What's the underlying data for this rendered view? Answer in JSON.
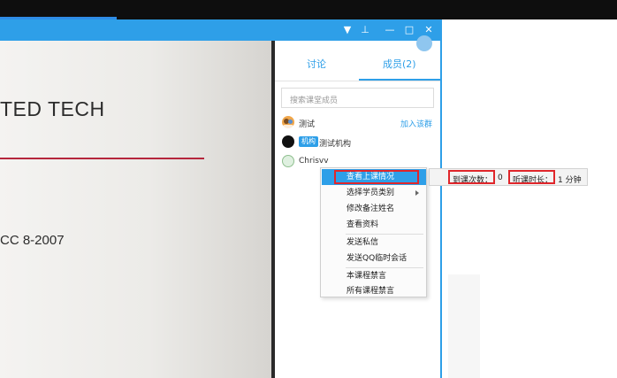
{
  "window": {
    "controls": [
      "▼",
      "⊥",
      "—",
      "□",
      "✕"
    ]
  },
  "slide": {
    "title_fragment": "TED TECH",
    "subtitle_fragment": "CC 8-2007",
    "accent_color": "#b5263c"
  },
  "panel": {
    "tabs": [
      {
        "label": "讨论",
        "active": false
      },
      {
        "label": "成员(2)",
        "active": true
      }
    ],
    "search_placeholder": "搜索课堂成员",
    "members": [
      {
        "name": "测试",
        "avatar": "group-avatar-icon",
        "action": "加入该群"
      },
      {
        "name": "测试机构",
        "avatar": "org-avatar-icon",
        "badge": "机构"
      },
      {
        "name": "Chrisvv",
        "avatar": "user-avatar-icon"
      }
    ]
  },
  "context_menu": {
    "items": [
      {
        "label": "查看上课情况",
        "highlighted": true
      },
      {
        "label": "选择学员类别",
        "submenu": true
      },
      {
        "label": "修改备注姓名"
      },
      {
        "label": "查看资料"
      },
      {
        "label": "发送私信"
      },
      {
        "label": "发送QQ临时会话"
      },
      {
        "label": "本课程禁言"
      },
      {
        "label": "所有课程禁言"
      }
    ]
  },
  "stats": {
    "attendance_label": "到课次数：",
    "attendance_value": "0",
    "duration_label": "听课时长：",
    "duration_value": "1 分钟"
  },
  "colors": {
    "accent": "#2e9fe8",
    "highlight_box": "#e0262b"
  }
}
